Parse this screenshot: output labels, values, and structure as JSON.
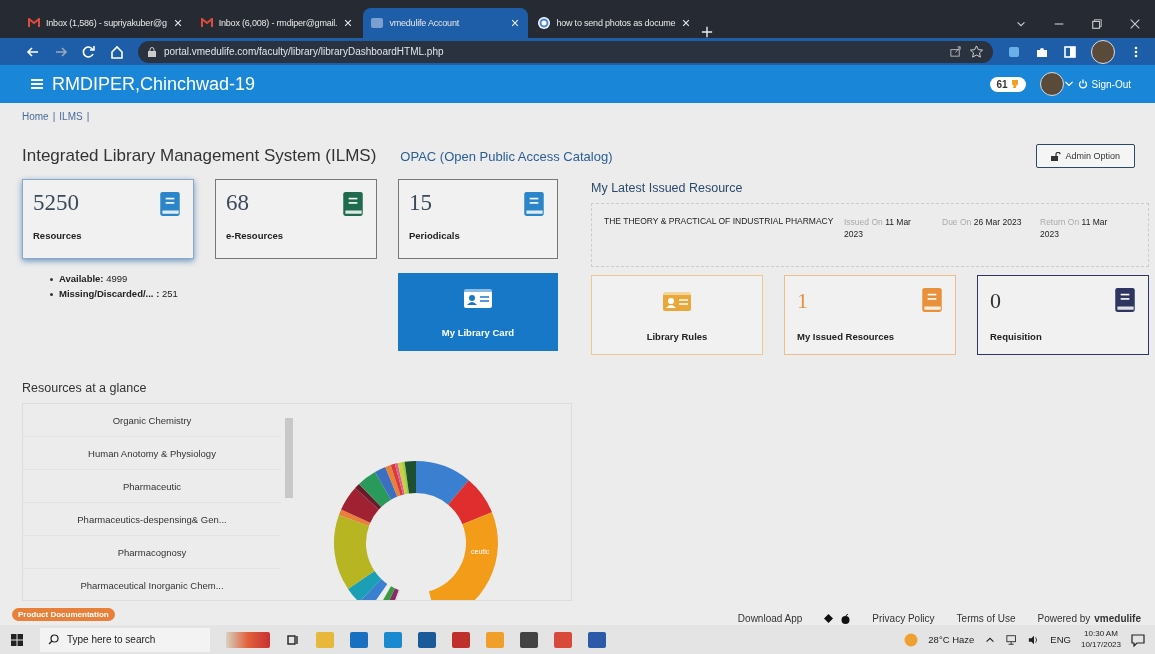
{
  "browser": {
    "tabs": [
      {
        "kind": "gmail",
        "title": "Inbox (1,586) - supriyakuber@g",
        "selected": false
      },
      {
        "kind": "gmail",
        "title": "Inbox (6,008) - rmdiper@gmail.",
        "selected": false
      },
      {
        "kind": "site",
        "title": "vmedulife Account",
        "selected": true
      },
      {
        "kind": "google",
        "title": "how to send photos as docume",
        "selected": false
      }
    ],
    "url": "portal.vmedulife.com/faculty/library/libraryDashboardHTML.php"
  },
  "app_header": {
    "title": "RMDIPER,Chinchwad-19",
    "points": "61",
    "sign_out": "Sign-Out"
  },
  "breadcrumb": {
    "items": [
      "Home",
      "ILMS"
    ],
    "separator": "|"
  },
  "page_title": "Integrated Library Management System (ILMS)",
  "opac_link": "OPAC (Open Public Access Catalog)",
  "admin_button": "Admin Option",
  "stat_cards": [
    {
      "value": "5250",
      "label": "Resources",
      "color": "#2a86c8",
      "selected": true
    },
    {
      "value": "68",
      "label": "e-Resources",
      "color": "#1f6b4e",
      "selected": false
    },
    {
      "value": "15",
      "label": "Periodicals",
      "color": "#2a86c8",
      "selected": false
    }
  ],
  "resource_breakdown": [
    {
      "label": "Available:",
      "value": "4999"
    },
    {
      "label": "Missing/Discarded/... :",
      "value": "251"
    }
  ],
  "library_card_button": "My Library Card",
  "latest_issued": {
    "heading": "My Latest Issued Resource",
    "title": "THE THEORY & PRACTICAL OF INDUSTRIAL PHARMACY",
    "dates": [
      {
        "label": "Issued On",
        "value": "11 Mar 2023"
      },
      {
        "label": "Due On",
        "value": "26 Mar 2023"
      },
      {
        "label": "Return On",
        "value": "11 Mar 2023"
      }
    ]
  },
  "action_cards": [
    {
      "kind": "rules",
      "label": "Library Rules",
      "color": "#e9a83a"
    },
    {
      "kind": "count",
      "value": "1",
      "label": "My Issued Resources",
      "color": "#e8913a"
    },
    {
      "kind": "count",
      "value": "0",
      "label": "Requisition",
      "color": "#2d3560"
    }
  ],
  "glance": {
    "heading": "Resources at a glance",
    "categories": [
      "Organic Chemistry",
      "Human Anotomy & Physiology",
      "Pharmaceutic",
      "Pharmaceutics-despensing& Gen...",
      "Pharmacognosy",
      "Pharmaceutical Inorganic Chem..."
    ],
    "chart_label": "ceutic"
  },
  "footer": {
    "download": "Download App",
    "links": [
      "Privacy Policy",
      "Terms of Use"
    ],
    "powered_by": "Powered by",
    "brand": "vmedulife"
  },
  "doc_badge": "Product Documentation",
  "taskbar": {
    "search_placeholder": "Type here to search",
    "weather": "28°C  Haze",
    "lang": "ENG",
    "time": "10:30 AM",
    "date": "10/17/2023"
  }
}
